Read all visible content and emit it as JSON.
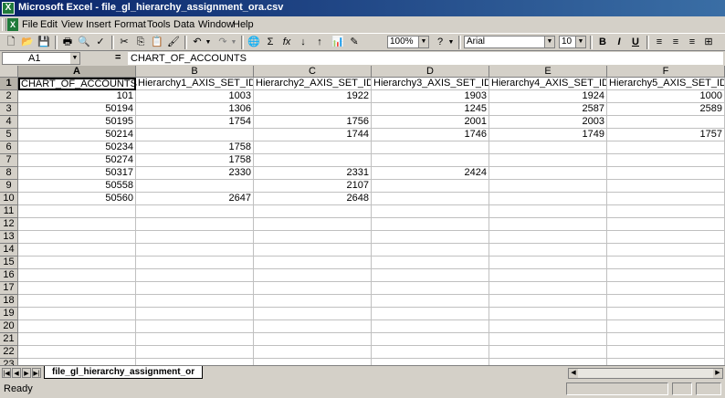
{
  "window": {
    "app_name": "Microsoft Excel",
    "title": "Microsoft Excel - file_gl_hierarchy_assignment_ora.csv"
  },
  "menu": [
    "File",
    "Edit",
    "View",
    "Insert",
    "Format",
    "Tools",
    "Data",
    "Window",
    "Help"
  ],
  "toolbar": {
    "zoom": "100%",
    "font_name": "Arial",
    "font_size": "10",
    "bold": "B",
    "italic": "I",
    "underline": "U",
    "sum_symbol": "Σ",
    "fx_symbol": "fx",
    "undo_symbol": "↶",
    "redo_symbol": "↷"
  },
  "formula_bar": {
    "cell_ref": "A1",
    "equals": "=",
    "content": "CHART_OF_ACCOUNTS"
  },
  "sheet": {
    "columns": [
      "A",
      "B",
      "C",
      "D",
      "E",
      "F"
    ],
    "rows": [
      "1",
      "2",
      "3",
      "4",
      "5",
      "6",
      "7",
      "8",
      "9",
      "10",
      "11",
      "12",
      "13",
      "14",
      "15",
      "16",
      "17",
      "18",
      "19",
      "20",
      "21",
      "22",
      "23"
    ],
    "headers": [
      "CHART_OF_ACCOUNTS",
      "Hierarchy1_AXIS_SET_ID",
      "Hierarchy2_AXIS_SET_ID",
      "Hierarchy3_AXIS_SET_ID",
      "Hierarchy4_AXIS_SET_ID",
      "Hierarchy5_AXIS_SET_ID"
    ],
    "data": [
      [
        "101",
        "1003",
        "1922",
        "1903",
        "1924",
        "1000"
      ],
      [
        "50194",
        "1306",
        "",
        "1245",
        "2587",
        "2589"
      ],
      [
        "50195",
        "1754",
        "1756",
        "2001",
        "2003",
        ""
      ],
      [
        "50214",
        "",
        "1744",
        "1746",
        "1749",
        "1757"
      ],
      [
        "50234",
        "1758",
        "",
        "",
        "",
        ""
      ],
      [
        "50274",
        "1758",
        "",
        "",
        "",
        ""
      ],
      [
        "50317",
        "2330",
        "2331",
        "2424",
        "",
        ""
      ],
      [
        "50558",
        "",
        "2107",
        "",
        "",
        ""
      ],
      [
        "50560",
        "2647",
        "2648",
        "",
        "",
        ""
      ]
    ]
  },
  "sheet_tab": "file_gl_hierarchy_assignment_or",
  "status": "Ready"
}
